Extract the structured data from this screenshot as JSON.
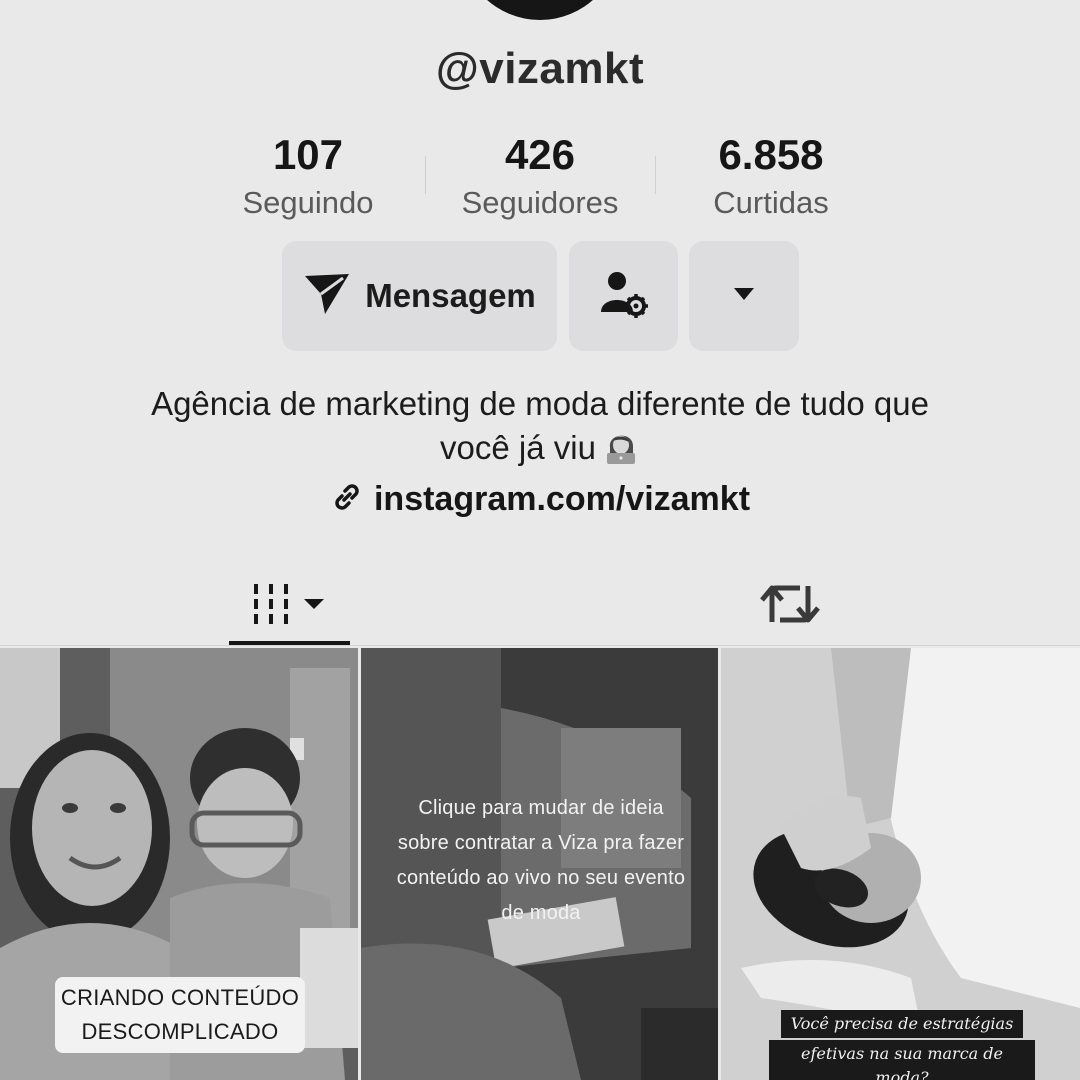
{
  "profile": {
    "username": "@vizamkt",
    "bio_line1": "Agência de marketing de moda diferente de tudo que",
    "bio_line2": "você já viu",
    "bio_emoji": "woman-technologist-emoji",
    "link": "instagram.com/vizamkt"
  },
  "stats": [
    {
      "value": "107",
      "label": "Seguindo"
    },
    {
      "value": "426",
      "label": "Seguidores"
    },
    {
      "value": "6.858",
      "label": "Curtidas"
    }
  ],
  "actions": {
    "message_label": "Mensagem",
    "message_icon": "send-icon",
    "person_icon": "person-settings-icon",
    "more_icon": "caret-down-icon"
  },
  "tabs": {
    "videos_icon": "grid-icon",
    "repost_icon": "repost-icon",
    "active": "videos"
  },
  "videos": [
    {
      "caption_line1": "CRIANDO CONTEÚDO",
      "caption_line2": "DESCOMPLICADO"
    },
    {
      "caption_line1": "Clique para mudar de ideia",
      "caption_line2": "sobre contratar a Viza pra fazer",
      "caption_line3": "conteúdo ao vivo no seu evento",
      "caption_line4": "de moda"
    },
    {
      "caption_line1": "Você precisa de estratégias",
      "caption_line2": "efetivas na sua marca de moda?"
    }
  ],
  "colors": {
    "background": "#e9e9ea",
    "button": "#dddddf",
    "text": "#161616",
    "muted": "#5a5a5a"
  }
}
